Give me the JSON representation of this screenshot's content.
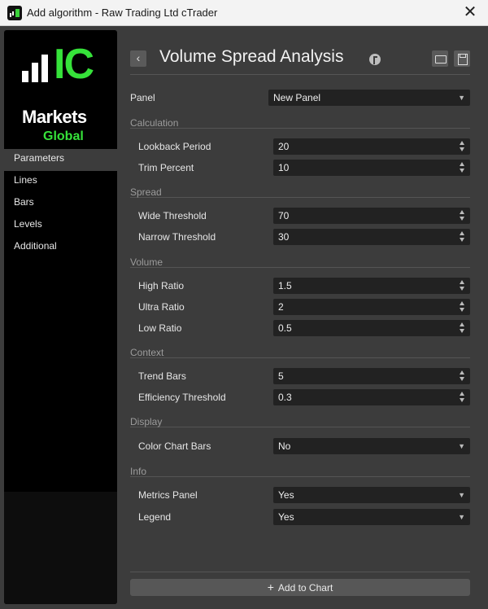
{
  "window": {
    "title": "Add algorithm - Raw Trading Ltd cTrader",
    "close_glyph": "✕"
  },
  "logo": {
    "ic": "IC",
    "markets": "Markets",
    "global": "Global"
  },
  "sidebar": {
    "items": [
      {
        "label": "Parameters",
        "active": true
      },
      {
        "label": "Lines"
      },
      {
        "label": "Bars"
      },
      {
        "label": "Levels"
      },
      {
        "label": "Additional"
      }
    ]
  },
  "header": {
    "back_glyph": "‹",
    "title": "Volume Spread Analysis"
  },
  "form": {
    "panel": {
      "label": "Panel",
      "value": "New Panel"
    },
    "sections": {
      "calculation": "Calculation",
      "spread": "Spread",
      "volume": "Volume",
      "context": "Context",
      "display": "Display",
      "info": "Info"
    },
    "params": {
      "lookback_period": {
        "label": "Lookback Period",
        "value": "20"
      },
      "trim_percent": {
        "label": "Trim Percent",
        "value": "10"
      },
      "wide_threshold": {
        "label": "Wide Threshold",
        "value": "70"
      },
      "narrow_threshold": {
        "label": "Narrow Threshold",
        "value": "30"
      },
      "high_ratio": {
        "label": "High Ratio",
        "value": "1.5"
      },
      "ultra_ratio": {
        "label": "Ultra Ratio",
        "value": "2"
      },
      "low_ratio": {
        "label": "Low Ratio",
        "value": "0.5"
      },
      "trend_bars": {
        "label": "Trend Bars",
        "value": "5"
      },
      "efficiency_threshold": {
        "label": "Efficiency Threshold",
        "value": "0.3"
      },
      "color_chart_bars": {
        "label": "Color Chart Bars",
        "value": "No"
      },
      "metrics_panel": {
        "label": "Metrics Panel",
        "value": "Yes"
      },
      "legend": {
        "label": "Legend",
        "value": "Yes"
      }
    }
  },
  "footer": {
    "add_label": "Add to Chart",
    "plus_glyph": "+"
  },
  "colors": {
    "accent_green": "#36e23a",
    "background": "#3c3c3c",
    "field": "#222222"
  }
}
